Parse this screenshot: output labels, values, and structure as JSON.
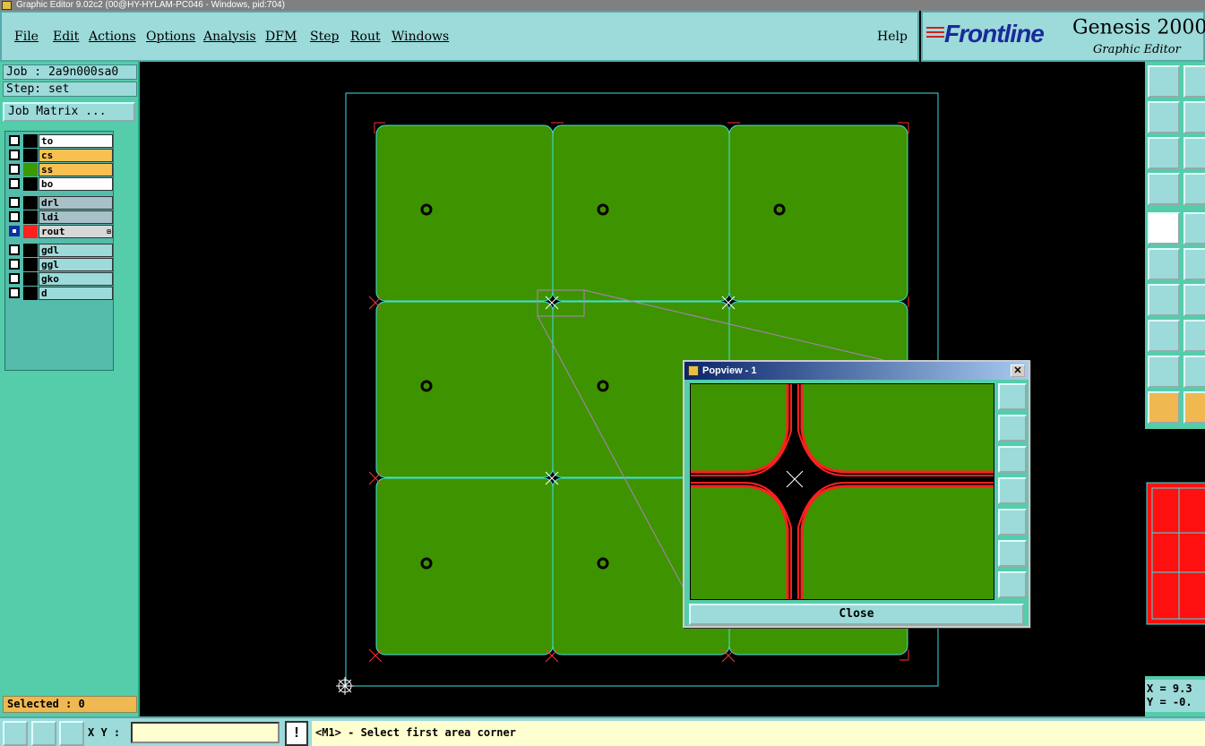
{
  "window": {
    "title": "Graphic Editor 9.02c2 (00@HY-HYLAM-PC046 - Windows, pid:704)"
  },
  "menu": {
    "items": [
      "File",
      "Edit",
      "Actions",
      "Options",
      "Analysis",
      "DFM",
      "Step",
      "Rout",
      "Windows"
    ],
    "help": "Help"
  },
  "logo": {
    "brand": "Frontline",
    "product": "Genesis 2000",
    "superscript": "2",
    "subtitle": "Graphic Editor"
  },
  "job": {
    "job_label": "Job : 2a9n000sa0",
    "step_label": "Step: set",
    "matrix_button": "Job Matrix ..."
  },
  "layers": [
    {
      "name": "to",
      "color": "#ffffff",
      "swatch": "#000000",
      "active": false
    },
    {
      "name": "cs",
      "color": "#f8c050",
      "swatch": "#000000",
      "active": false
    },
    {
      "name": "ss",
      "color": "#f8c050",
      "swatch": "#3a9a00",
      "active": false
    },
    {
      "name": "bo",
      "color": "#ffffff",
      "swatch": "#000000",
      "active": false
    },
    {
      "name": "drl",
      "color": "#a8c0c8",
      "swatch": "#000000",
      "active": false
    },
    {
      "name": "ldi",
      "color": "#a8c0c8",
      "swatch": "#000000",
      "active": false
    },
    {
      "name": "rout",
      "color": "#d8d8d8",
      "swatch": "#ff2020",
      "active": true
    },
    {
      "name": "gdl",
      "color": "#9ddada",
      "swatch": "#000000",
      "active": false
    },
    {
      "name": "ggl",
      "color": "#9ddada",
      "swatch": "#000000",
      "active": false
    },
    {
      "name": "gko",
      "color": "#9ddada",
      "swatch": "#000000",
      "active": false
    },
    {
      "name": "d",
      "color": "#9ddada",
      "swatch": "#000000",
      "active": false
    }
  ],
  "selected": "Selected : 0",
  "popview": {
    "title": "Popview - 1",
    "close_x": "✕",
    "close_button": "Close"
  },
  "coords": {
    "x": "X = 9.3",
    "y": "Y = -0."
  },
  "bottom": {
    "xy_label": "X Y :",
    "xy_value": "",
    "excl": "!",
    "status": "<M1> - Select first area corner"
  },
  "colors": {
    "board": "#3e9300",
    "outline": "#40e0e0",
    "rout": "#ff2020",
    "panel_bg": "#55ccaa",
    "button_bg": "#9ddada"
  }
}
